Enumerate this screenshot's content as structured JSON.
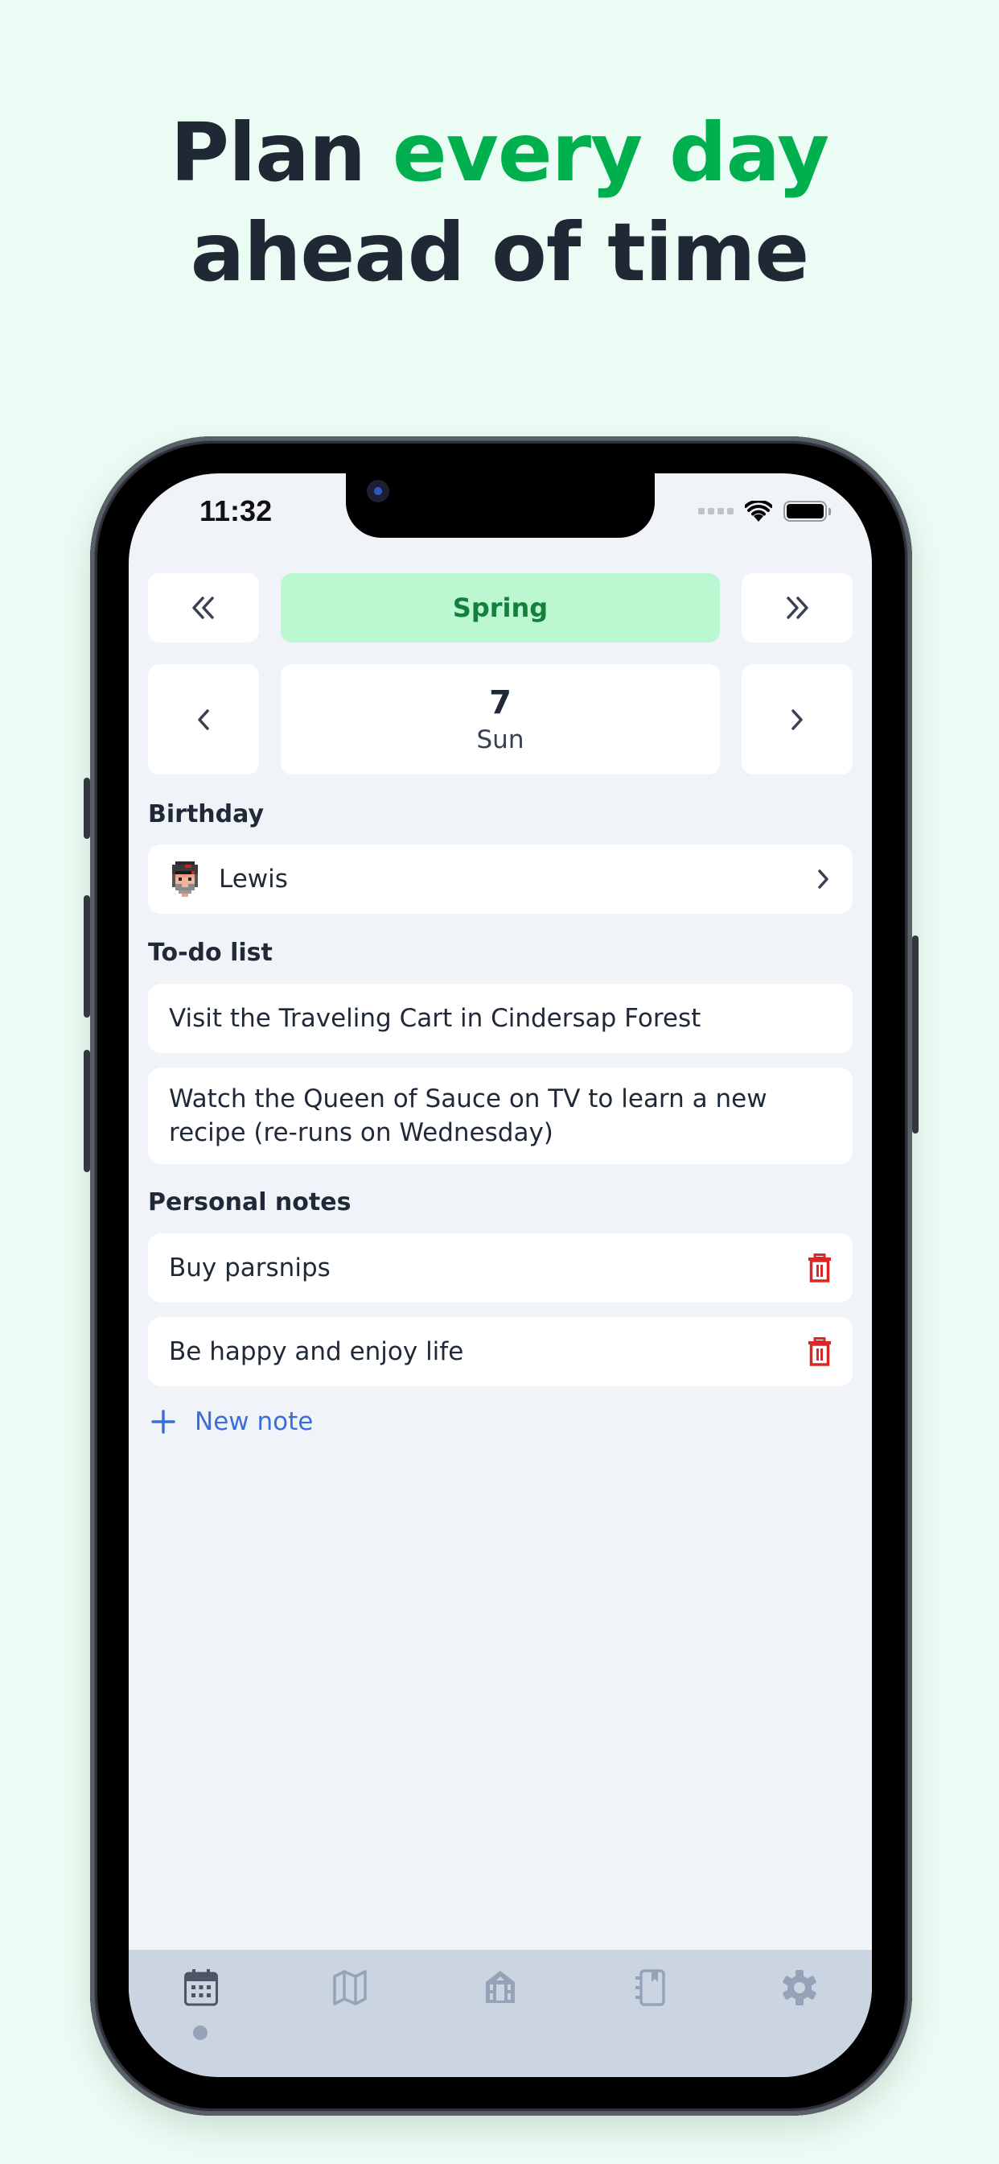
{
  "headline": {
    "line1_prefix": "Plan ",
    "line1_accent": "every day",
    "line2": "ahead of time"
  },
  "colors": {
    "accent_green": "#00b04f",
    "season_bg": "#bbf7d0",
    "season_text": "#15803d",
    "link_blue": "#3b6fd8",
    "danger_red": "#dc2626",
    "tabbar_bg": "#cbd5e1"
  },
  "status_bar": {
    "time": "11:32",
    "icons": [
      "signal-icon",
      "wifi-icon",
      "battery-icon"
    ]
  },
  "calendar": {
    "prev_season_icon": "double-chevron-left-icon",
    "season": "Spring",
    "next_season_icon": "double-chevron-right-icon",
    "prev_day_icon": "chevron-left-icon",
    "day_number": "7",
    "day_name": "Sun",
    "next_day_icon": "chevron-right-icon"
  },
  "birthday": {
    "title": "Birthday",
    "person": "Lewis"
  },
  "todo": {
    "title": "To-do list",
    "items": [
      {
        "text": "Visit the Traveling Cart in Cindersap Forest"
      },
      {
        "text": "Watch the Queen of Sauce on TV to learn a new recipe (re-runs on Wednesday)"
      }
    ]
  },
  "notes": {
    "title": "Personal notes",
    "items": [
      {
        "text": "Buy parsnips"
      },
      {
        "text": "Be happy and enjoy life"
      }
    ],
    "new_note_label": "New note"
  },
  "tabbar": {
    "active_index": 0,
    "tabs": [
      {
        "icon": "calendar-icon"
      },
      {
        "icon": "map-icon"
      },
      {
        "icon": "building-icon"
      },
      {
        "icon": "notebook-icon"
      },
      {
        "icon": "gear-icon"
      }
    ]
  }
}
